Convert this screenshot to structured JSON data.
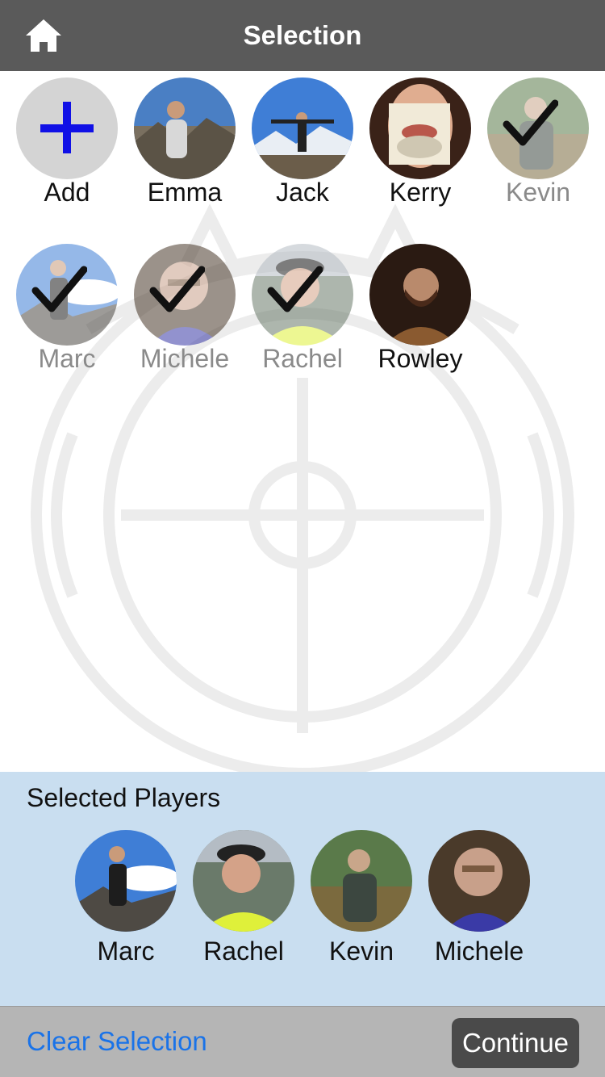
{
  "header": {
    "title": "Selection",
    "home_icon": "home-icon"
  },
  "players": [
    {
      "name": "Add",
      "type": "add",
      "selected": false
    },
    {
      "name": "Emma",
      "selected": false
    },
    {
      "name": "Jack",
      "selected": false
    },
    {
      "name": "Kerry",
      "selected": false
    },
    {
      "name": "Kevin",
      "selected": true
    },
    {
      "name": "Marc",
      "selected": true
    },
    {
      "name": "Michele",
      "selected": true
    },
    {
      "name": "Rachel",
      "selected": true
    },
    {
      "name": "Rowley",
      "selected": false
    }
  ],
  "selected_panel": {
    "heading": "Selected Players",
    "players": [
      {
        "name": "Marc"
      },
      {
        "name": "Rachel"
      },
      {
        "name": "Kevin"
      },
      {
        "name": "Michele"
      }
    ]
  },
  "footer": {
    "clear_label": "Clear Selection",
    "continue_label": "Continue"
  },
  "colors": {
    "nav_bar": "#5a5a5a",
    "selected_panel_bg": "#c9def0",
    "bottom_bar": "#b5b5b5",
    "link_blue": "#1a73e8",
    "add_plus": "#1010e6"
  }
}
